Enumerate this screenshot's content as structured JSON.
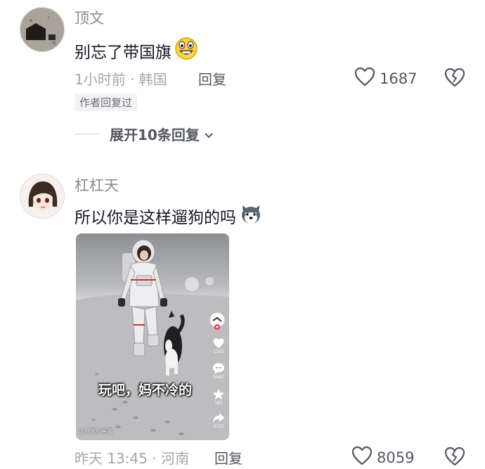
{
  "comments": [
    {
      "username": "顶文",
      "text": "别忘了带国旗",
      "emoji": "grinning-emoji",
      "meta": "1小时前 · 韩国",
      "reply_label": "回复",
      "like_count": "1687",
      "author_badge": "作者回复过",
      "expand_label": "展开10条回复"
    },
    {
      "username": "杠杠天",
      "text": "所以你是这样遛狗的吗",
      "emoji": "husky-dog-emoji",
      "meta": "昨天 13:45 · 河南",
      "reply_label": "回复",
      "like_count": "8059",
      "video": {
        "caption": "玩吧，妈不冷的",
        "watermark": "@悬佬小画家",
        "side_counts": [
          "1703",
          "1482",
          "183",
          "3722"
        ]
      }
    }
  ]
}
